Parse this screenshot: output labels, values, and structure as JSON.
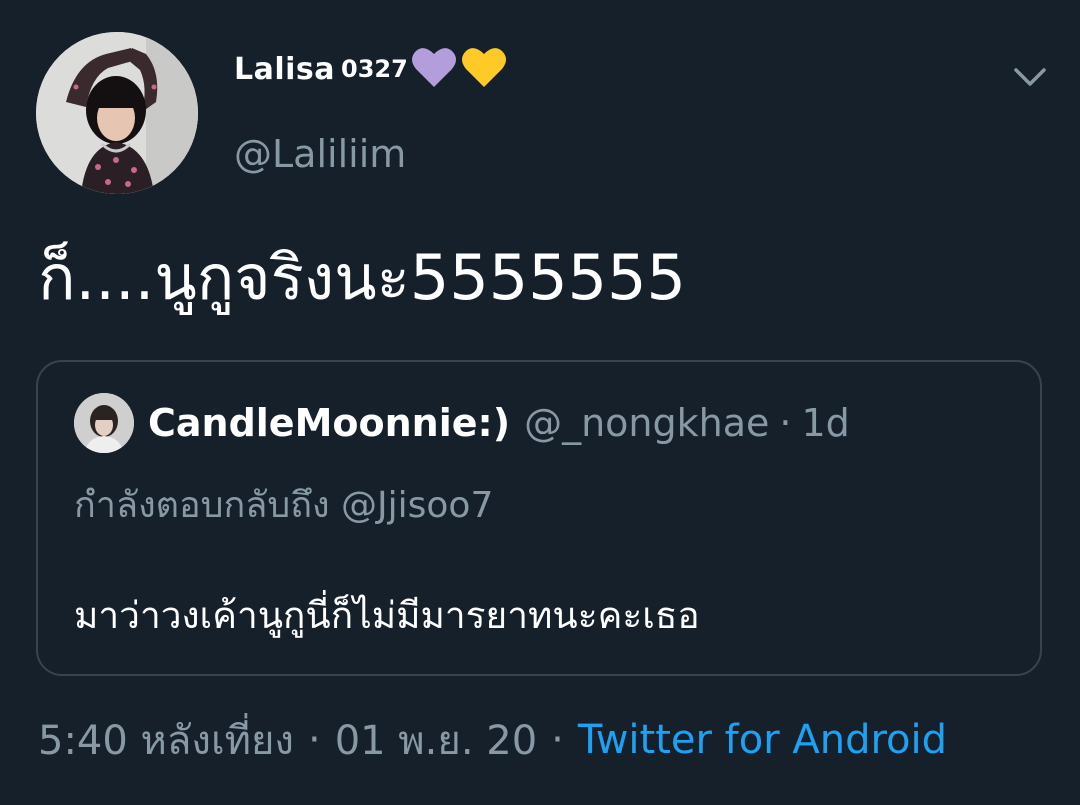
{
  "tweet": {
    "display_name": "Lalisa",
    "display_name_suffix": "0327",
    "display_name_emojis": [
      "purple-heart",
      "yellow-heart"
    ],
    "handle": "@Laliliim",
    "text": "ก็....นูกูจริงนะ5555555",
    "menu_icon": "chevron-down-icon"
  },
  "quoted_tweet": {
    "display_name": "CandleMoonnie:)",
    "handle": "@_nongkhae",
    "separator": "·",
    "time": "1d",
    "reply_to": "กำลังตอบกลับถึง @Jjisoo7",
    "text": "มาว่าวงเค้านูกูนี่ก็ไม่มีมารยาทนะคะเธอ"
  },
  "footer": {
    "time": "5:40 หลังเที่ยง",
    "separator": "·",
    "date": "01 พ.ย. 20",
    "source": "Twitter for Android"
  },
  "colors": {
    "background": "#15202b",
    "primary_text": "#ffffff",
    "secondary_text": "#8899a6",
    "link": "#1da1f2",
    "border": "#38444d",
    "purple_heart": "#b39ddb",
    "yellow_heart": "#ffca28"
  }
}
